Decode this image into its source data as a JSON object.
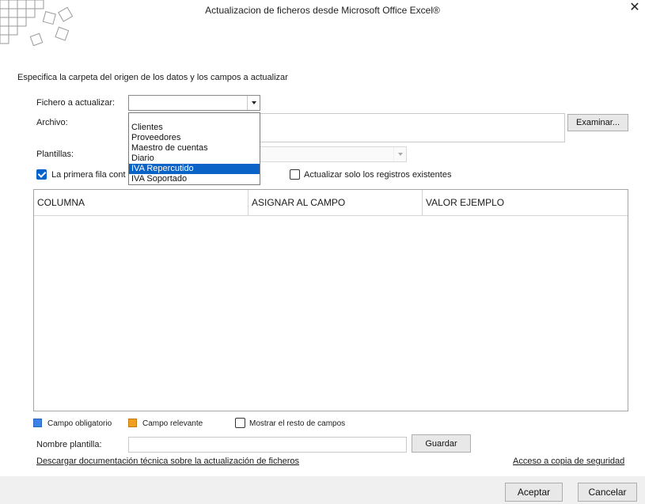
{
  "window": {
    "title": "Actualizacion de ficheros desde Microsoft Office Excel®",
    "close_label": "✕"
  },
  "form": {
    "instruction": "Especifica la carpeta del origen de los datos y los campos a actualizar",
    "fichero_label": "Fichero a actualizar:",
    "fichero_value": "",
    "archivo_label": "Archivo:",
    "examinar_label": "Examinar...",
    "plantillas_label": "Plantillas:",
    "first_row_label": "La primera fila cont",
    "first_row_checked": true,
    "update_existing_label": "Actualizar solo los registros existentes",
    "update_existing_checked": false
  },
  "dropdown": {
    "items": [
      "Clientes",
      "Proveedores",
      "Maestro de cuentas",
      "Diario",
      "IVA Repercutido",
      "IVA Soportado"
    ],
    "selected": "IVA Repercutido"
  },
  "grid": {
    "columns": [
      "COLUMNA",
      "ASIGNAR AL CAMPO",
      "VALOR EJEMPLO"
    ]
  },
  "legend": {
    "obligatorio_label": "Campo obligatorio",
    "obligatorio_color": "#3b82e6",
    "relevante_label": "Campo relevante",
    "relevante_color": "#f0a01e",
    "mostrar_label": "Mostrar el resto de campos",
    "mostrar_checked": false
  },
  "template": {
    "nombre_label": "Nombre plantilla:",
    "nombre_value": "",
    "guardar_label": "Guardar"
  },
  "links": {
    "descargar": "Descargar documentación técnica sobre la actualización de ficheros",
    "copia": "Acceso a copia de seguridad"
  },
  "footer": {
    "aceptar_label": "Aceptar",
    "cancelar_label": "Cancelar"
  }
}
